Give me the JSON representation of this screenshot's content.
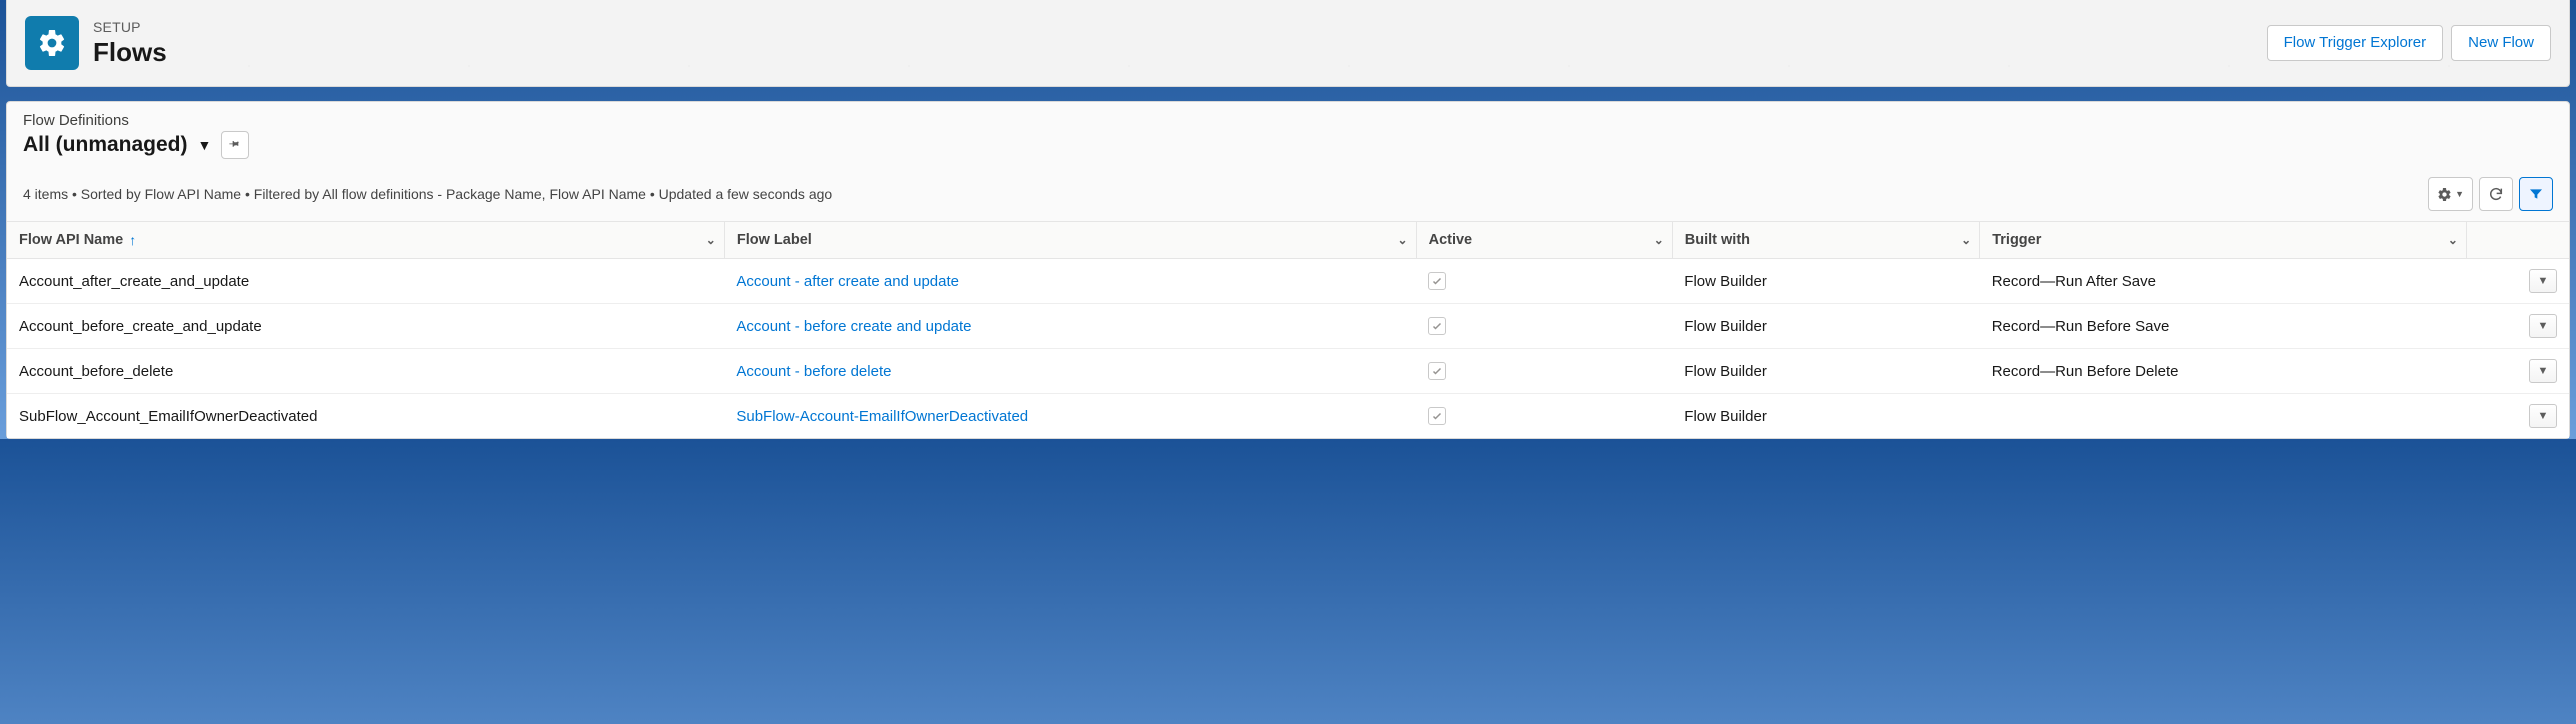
{
  "header": {
    "eyebrow": "SETUP",
    "title": "Flows",
    "buttons": {
      "explorer": "Flow Trigger Explorer",
      "newFlow": "New Flow"
    }
  },
  "list": {
    "objectLabel": "Flow Definitions",
    "viewName": "All (unmanaged)",
    "statusLine": "4 items • Sorted by Flow API Name • Filtered by All flow definitions - Package Name, Flow API Name • Updated a few seconds ago"
  },
  "columns": {
    "apiName": "Flow API Name",
    "label": "Flow Label",
    "active": "Active",
    "builtWith": "Built with",
    "trigger": "Trigger"
  },
  "rows": [
    {
      "apiName": "Account_after_create_and_update",
      "label": "Account - after create and update",
      "active": true,
      "builtWith": "Flow Builder",
      "trigger": "Record—Run After Save"
    },
    {
      "apiName": "Account_before_create_and_update",
      "label": "Account - before create and update",
      "active": true,
      "builtWith": "Flow Builder",
      "trigger": "Record—Run Before Save"
    },
    {
      "apiName": "Account_before_delete",
      "label": "Account - before delete",
      "active": true,
      "builtWith": "Flow Builder",
      "trigger": "Record—Run Before Delete"
    },
    {
      "apiName": "SubFlow_Account_EmailIfOwnerDeactivated",
      "label": "SubFlow-Account-EmailIfOwnerDeactivated",
      "active": true,
      "builtWith": "Flow Builder",
      "trigger": ""
    }
  ]
}
